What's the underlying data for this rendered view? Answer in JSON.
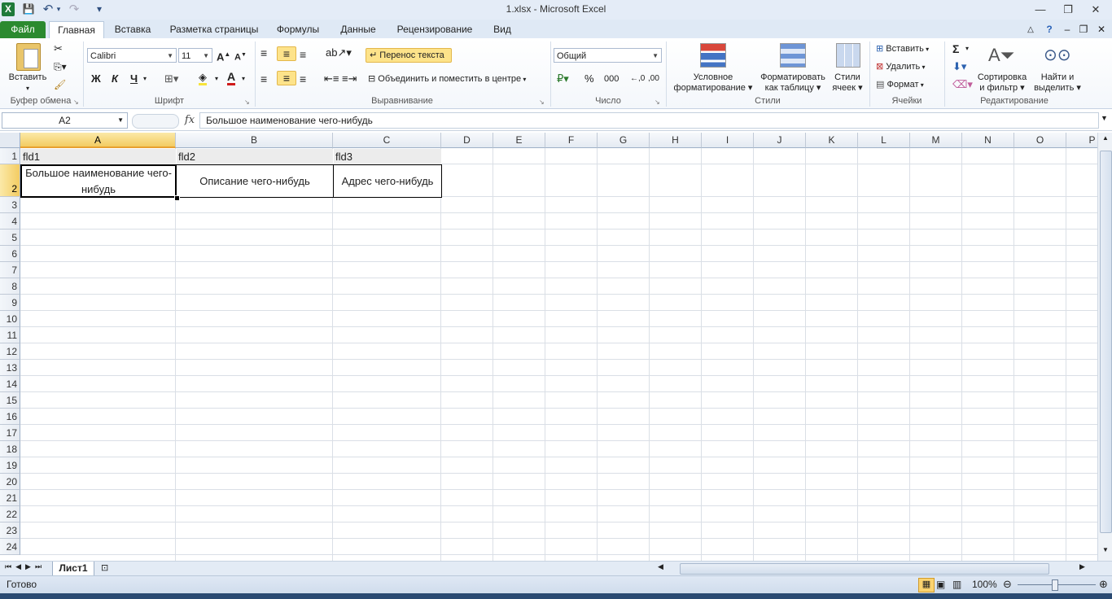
{
  "window": {
    "title": "1.xlsx  -  Microsoft Excel",
    "app_icon_letter": "X",
    "controls": {
      "minimize": "—",
      "maximize": "❐",
      "close": "✕"
    }
  },
  "quick_access": {
    "save": "💾",
    "undo": "↶",
    "redo": "↷",
    "customize": "▾"
  },
  "tabs": [
    {
      "label": "Файл"
    },
    {
      "label": "Главная"
    },
    {
      "label": "Вставка"
    },
    {
      "label": "Разметка страницы"
    },
    {
      "label": "Формулы"
    },
    {
      "label": "Данные"
    },
    {
      "label": "Рецензирование"
    },
    {
      "label": "Вид"
    }
  ],
  "ribbon": {
    "clipboard": {
      "group": "Буфер обмена",
      "paste": "Вставить"
    },
    "font": {
      "group": "Шрифт",
      "name": "Calibri",
      "size": "11",
      "bold": "Ж",
      "italic": "К",
      "underline": "Ч"
    },
    "alignment": {
      "group": "Выравнивание",
      "wrap_text": "Перенос текста",
      "merge": "Объединить и поместить в центре"
    },
    "number": {
      "group": "Число",
      "format": "Общий",
      "percent": "%",
      "thousands": "000"
    },
    "styles": {
      "group": "Стили",
      "conditional_1": "Условное",
      "conditional_2": "форматирование",
      "as_table_1": "Форматировать",
      "as_table_2": "как таблицу",
      "cell_styles_1": "Стили",
      "cell_styles_2": "ячеек"
    },
    "cells": {
      "group": "Ячейки",
      "insert": "Вставить",
      "delete": "Удалить",
      "format": "Формат"
    },
    "editing": {
      "group": "Редактирование",
      "sigma": "Σ",
      "sort_1": "Сортировка",
      "sort_2": "и фильтр",
      "find_1": "Найти и",
      "find_2": "выделить"
    }
  },
  "formula_bar": {
    "name_box": "A2",
    "fx": "fx",
    "content": "Большое наименование чего-нибудь"
  },
  "columns": [
    "A",
    "B",
    "C",
    "D",
    "E",
    "F",
    "G",
    "H",
    "I",
    "J",
    "K",
    "L",
    "M",
    "N",
    "O",
    "P"
  ],
  "rows": [
    "1",
    "2",
    "3",
    "4",
    "5",
    "6",
    "7",
    "8",
    "9",
    "10",
    "11",
    "12",
    "13",
    "14",
    "15",
    "16",
    "17",
    "18",
    "19",
    "20",
    "21",
    "22",
    "23",
    "24"
  ],
  "cells": {
    "A1": "fld1",
    "B1": "fld2",
    "C1": "fld3",
    "A2": "Большое наименование чего-нибудь",
    "B2": "Описание чего-нибудь",
    "C2": "Адрес чего-нибудь"
  },
  "sheets": [
    {
      "name": "Лист1"
    }
  ],
  "status": {
    "text": "Готово",
    "zoom": "100%"
  }
}
